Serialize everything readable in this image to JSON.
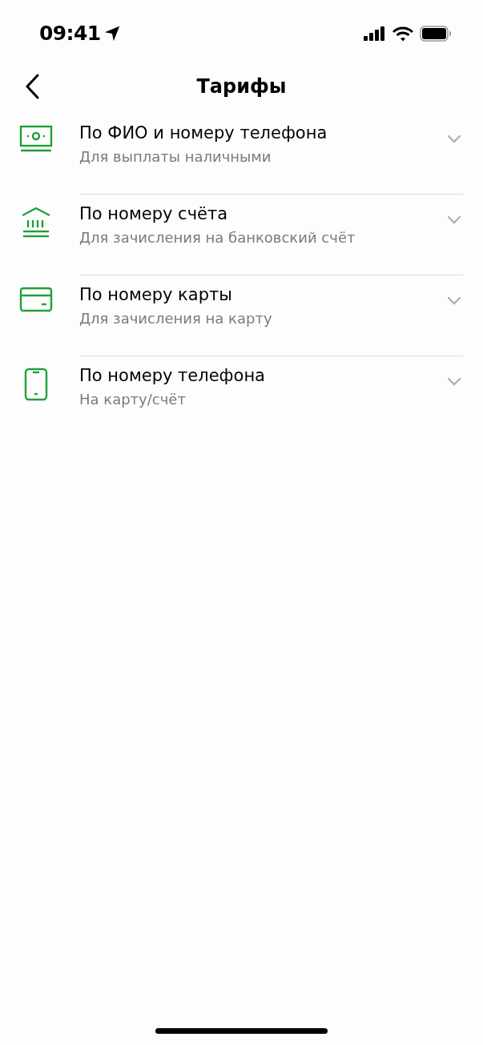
{
  "status_bar": {
    "time": "09:41"
  },
  "header": {
    "title": "Тарифы"
  },
  "items": [
    {
      "kind": "cash",
      "title": "По ФИО и номеру телефона",
      "subtitle": "Для выплаты наличными",
      "expanded": false
    },
    {
      "kind": "bank",
      "title": "По номеру счёта",
      "subtitle": "Для зачисления на банковский счёт",
      "expanded": false
    },
    {
      "kind": "card",
      "title": "По номеру карты",
      "subtitle": "Для зачисления на карту",
      "expanded": false
    },
    {
      "kind": "phone",
      "title": "По номеру телефона",
      "subtitle": "На карту/счёт",
      "expanded": false
    }
  ]
}
